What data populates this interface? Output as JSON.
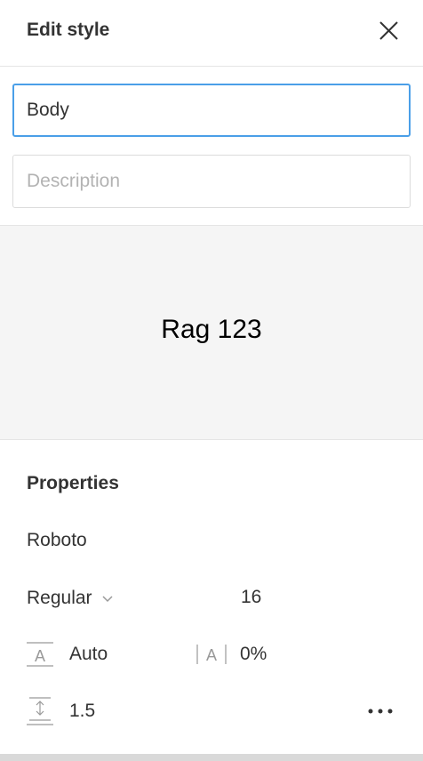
{
  "header": {
    "title": "Edit style",
    "close_icon": "close-icon"
  },
  "form": {
    "name_value": "Body",
    "description_placeholder": "Description",
    "description_value": ""
  },
  "preview": {
    "sample_text": "Rag 123"
  },
  "properties": {
    "section_title": "Properties",
    "font_family": "Roboto",
    "font_weight": "Regular",
    "font_size": "16",
    "line_height": "Auto",
    "letter_spacing": "0%",
    "paragraph_spacing": "1.5",
    "icons": {
      "line_height": "line-height-icon",
      "letter_spacing": "letter-spacing-icon",
      "paragraph_spacing": "paragraph-spacing-icon",
      "weight_dropdown": "chevron-down-icon",
      "more": "more-options-icon"
    }
  },
  "colors": {
    "focus_border": "#4a9fe8",
    "preview_bg": "#f5f5f5",
    "text": "#333333"
  }
}
